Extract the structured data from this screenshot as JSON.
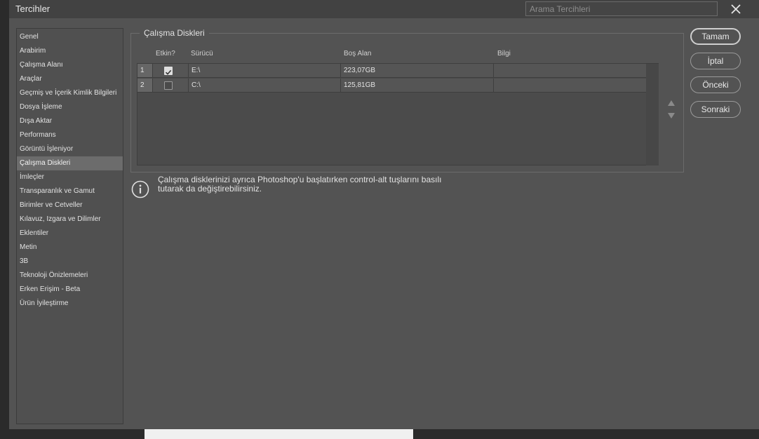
{
  "dialog": {
    "title": "Tercihler",
    "search_placeholder": "Arama Tercihleri"
  },
  "sidebar": {
    "items": [
      {
        "label": "Genel"
      },
      {
        "label": "Arabirim"
      },
      {
        "label": "Çalışma Alanı"
      },
      {
        "label": "Araçlar"
      },
      {
        "label": "Geçmiş ve İçerik Kimlik Bilgileri"
      },
      {
        "label": "Dosya İşleme"
      },
      {
        "label": "Dışa Aktar"
      },
      {
        "label": "Performans"
      },
      {
        "label": "Görüntü İşleniyor"
      },
      {
        "label": "Çalışma Diskleri",
        "active": true
      },
      {
        "label": "İmleçler"
      },
      {
        "label": "Transparanlık ve Gamut"
      },
      {
        "label": "Birimler ve Cetveller"
      },
      {
        "label": "Kılavuz, Izgara ve Dilimler"
      },
      {
        "label": "Eklentiler"
      },
      {
        "label": "Metin"
      },
      {
        "label": "3B"
      },
      {
        "label": "Teknoloji Önizlemeleri"
      },
      {
        "label": "Erken Erişim - Beta"
      },
      {
        "label": "Ürün İyileştirme"
      }
    ]
  },
  "scratch": {
    "group_title": "Çalışma Diskleri",
    "columns": {
      "active": "Etkin?",
      "drive": "Sürücü",
      "free": "Boş Alan",
      "info": "Bilgi"
    },
    "rows": [
      {
        "num": "1",
        "checked": true,
        "drive": "E:\\",
        "free": "223,07GB",
        "info": ""
      },
      {
        "num": "2",
        "checked": false,
        "drive": "C:\\",
        "free": "125,81GB",
        "info": ""
      }
    ],
    "info_line1": "Çalışma disklerinizi ayrıca Photoshop'u başlatırken control-alt tuşlarını basılı",
    "info_line2": "tutarak da değiştirebilirsiniz."
  },
  "buttons": {
    "ok": "Tamam",
    "cancel": "İptal",
    "prev": "Önceki",
    "next": "Sonraki"
  },
  "icons": {
    "close": "close-icon",
    "info": "info-icon",
    "up": "arrow-up-icon",
    "down": "arrow-down-icon",
    "check": "checkmark-icon"
  }
}
